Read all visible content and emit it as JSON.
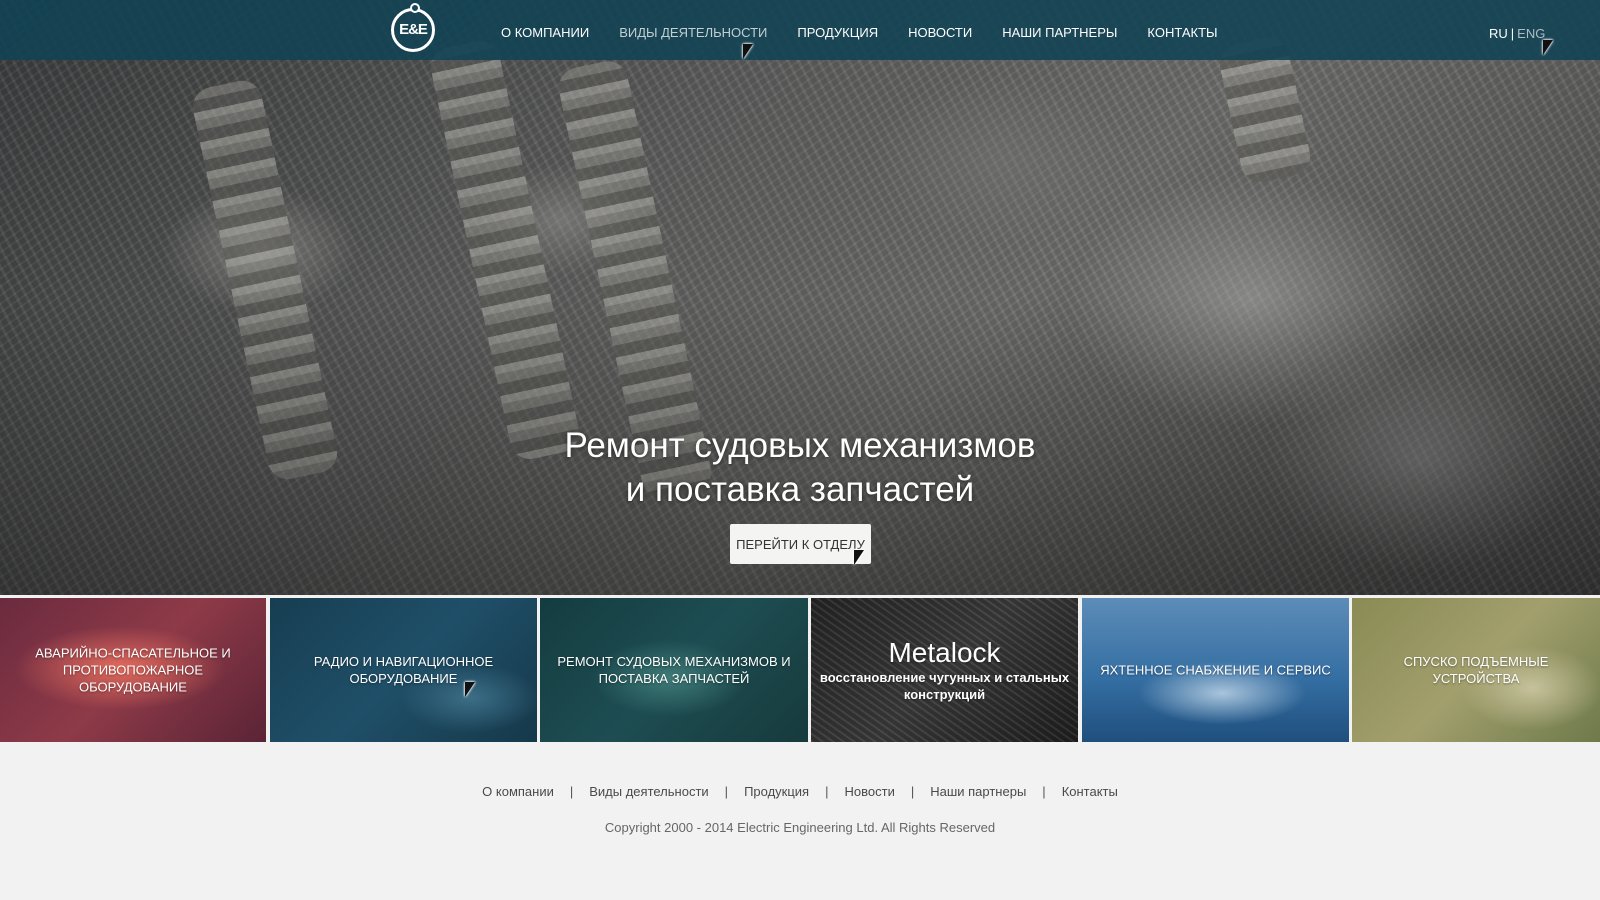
{
  "header": {
    "logo_text": "E&E",
    "nav": [
      {
        "label": "О КОМПАНИИ",
        "active": false
      },
      {
        "label": "ВИДЫ ДЕЯТЕЛЬНОСТИ",
        "active": true
      },
      {
        "label": "ПРОДУКЦИЯ",
        "active": false
      },
      {
        "label": "НОВОСТИ",
        "active": false
      },
      {
        "label": "НАШИ ПАРТНЕРЫ",
        "active": false
      },
      {
        "label": "КОНТАКТЫ",
        "active": false
      }
    ],
    "lang": {
      "current": "RU",
      "separator": "|",
      "other": "ENG"
    },
    "bar_color": "#104254"
  },
  "hero": {
    "title_line1": "Ремонт судовых механизмов",
    "title_line2": "и поставка запчастей",
    "button_label": "ПЕРЕЙТИ К ОТДЕЛУ"
  },
  "tiles": [
    {
      "label": "АВАРИЙНО-СПАСАТЕЛЬНОЕ И ПРОТИВОПОЖАРНОЕ ОБОРУДОВАНИЕ",
      "color": "#8e3a48",
      "active": false
    },
    {
      "label": "РАДИО И НАВИГАЦИОННОЕ ОБОРУДОВАНИЕ",
      "color": "#1f4f68",
      "active": true
    },
    {
      "label": "РЕМОНТ СУДОВЫХ МЕХАНИЗМОВ И ПОСТАВКА ЗАПЧАСТЕЙ",
      "color": "#1d4d52",
      "active": false
    },
    {
      "title": "Metalock",
      "label": "восстановление чугунных и стальных конструкций",
      "color": "#2e2e2e",
      "active": false
    },
    {
      "label": "ЯХТЕННОЕ СНАБЖЕНИЕ И СЕРВИС",
      "color": "#356fa3",
      "active": false
    },
    {
      "label": "СПУСКО ПОДЪЕМНЫЕ УСТРОЙСТВА",
      "color": "#8f8d5e",
      "active": false
    }
  ],
  "footer": {
    "links": [
      "О компании",
      "Виды деятельности",
      "Продукция",
      "Новости",
      "Наши партнеры",
      "Контакты"
    ],
    "separator": "|",
    "copyright": "Copyright 2000 - 2014 Electric Engineering Ltd. All Rights Reserved"
  }
}
